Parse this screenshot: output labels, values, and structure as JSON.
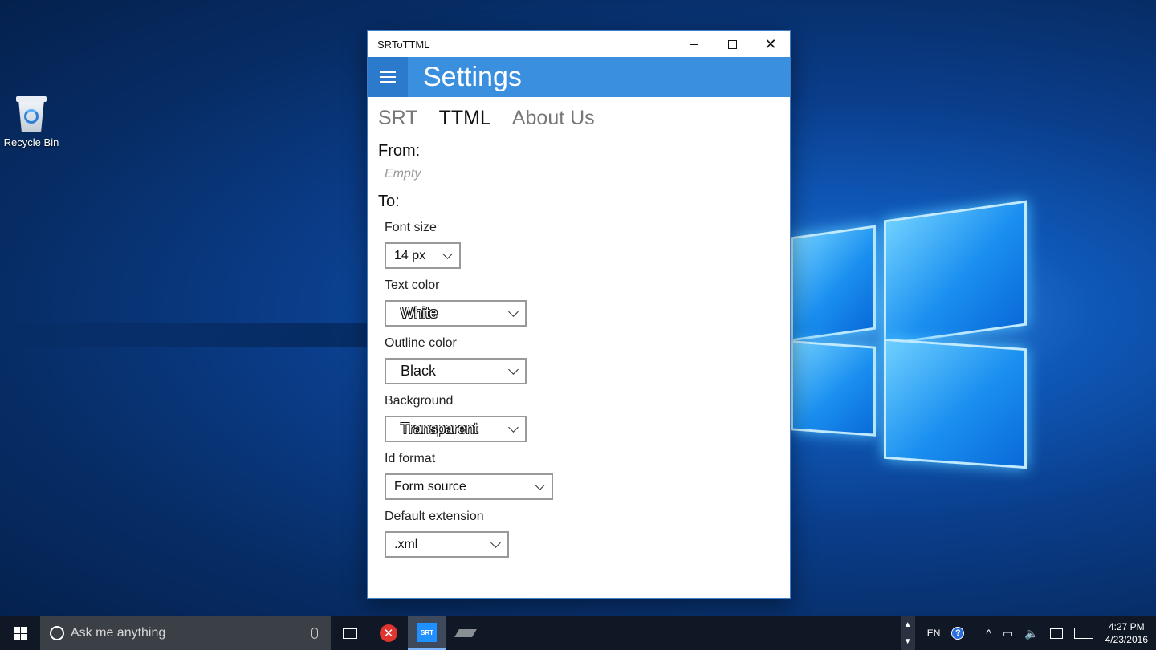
{
  "desktop": {
    "icons": [
      {
        "label": "Recycle Bin",
        "icon": "recycle-bin-icon"
      }
    ]
  },
  "window": {
    "title": "SRToTTML",
    "header": {
      "title": "Settings"
    },
    "tabs": [
      {
        "label": "SRT",
        "active": false
      },
      {
        "label": "TTML",
        "active": true
      },
      {
        "label": "About Us",
        "active": false
      }
    ],
    "from": {
      "label": "From:",
      "value": "Empty"
    },
    "to": {
      "label": "To:",
      "fields": [
        {
          "label": "Font size",
          "value": "14 px"
        },
        {
          "label": "Text color",
          "value": "White"
        },
        {
          "label": "Outline color",
          "value": "Black"
        },
        {
          "label": "Background",
          "value": "Transparent"
        },
        {
          "label": "Id format",
          "value": "Form source"
        },
        {
          "label": "Default extension",
          "value": ".xml"
        }
      ]
    }
  },
  "taskbar": {
    "search_placeholder": "Ask me anything",
    "apps": [
      {
        "icon": "task-view-icon"
      },
      {
        "icon": "error-app-icon"
      },
      {
        "icon": "srt-app-icon",
        "label": "SRT",
        "active": true
      },
      {
        "icon": "gray-app-icon"
      }
    ],
    "tray": {
      "language": "EN",
      "time": "4:27 PM",
      "date": "4/23/2016"
    }
  },
  "colors": {
    "accent": "#3b8fdf",
    "hamburger_bg": "#2b7acc",
    "taskbar": "#101826"
  }
}
